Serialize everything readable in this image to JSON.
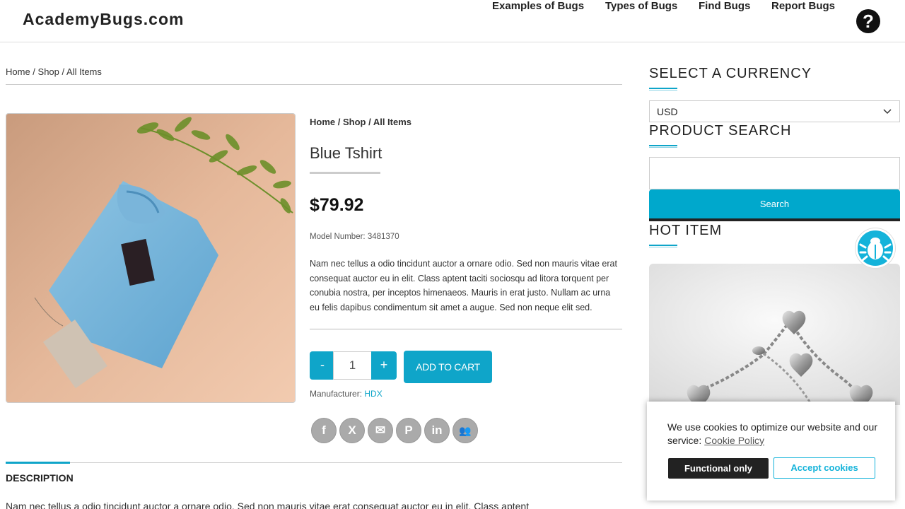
{
  "header": {
    "logo": "AcademyBugs.com",
    "nav": [
      "Examples of Bugs",
      "Types of Bugs",
      "Find Bugs",
      "Report Bugs"
    ],
    "help_icon": "question-circle-icon",
    "help_glyph": "?"
  },
  "breadcrumb_top": {
    "home": "Home",
    "sep1": " / ",
    "shop": "Shop",
    "sep2": " / ",
    "current": "All Items"
  },
  "product": {
    "breadcrumb": {
      "home": "Home",
      "sep1": " / ",
      "shop": "Shop",
      "sep2": " / ",
      "current": "All Items"
    },
    "title": "Blue Tshirt",
    "price": "$79.92",
    "model_label": "Model Number:",
    "model_number": "3481370",
    "description": "Nam nec tellus a odio tincidunt auctor a ornare odio. Sed non mauris vitae erat consequat auctor eu in elit. Class aptent taciti sociosqu ad litora torquent per conubia nostra, per inceptos himenaeos. Mauris in erat justo. Nullam ac urna eu felis dapibus condimentum sit amet a augue. Sed non neque elit sed.",
    "qty_minus": "-",
    "qty_value": "1",
    "qty_plus": "+",
    "add_to_cart": "ADD TO CART",
    "manufacturer_label": "Manufacturer:",
    "manufacturer": "HDX",
    "share_icons": [
      {
        "name": "facebook-icon",
        "glyph": "f"
      },
      {
        "name": "x-twitter-icon",
        "glyph": "X"
      },
      {
        "name": "email-icon",
        "glyph": "✉"
      },
      {
        "name": "pinterest-icon",
        "glyph": "P"
      },
      {
        "name": "linkedin-icon",
        "glyph": "in"
      },
      {
        "name": "myspace-icon",
        "glyph": "👥"
      }
    ]
  },
  "tabs": {
    "description_tab": "DESCRIPTION",
    "description_text": "Nam nec tellus a odio tincidunt auctor a ornare odio. Sed non mauris vitae erat consequat auctor eu in elit. Class aptent"
  },
  "sidebar": {
    "currency_heading": "SELECT A CURRENCY",
    "currency_value": "USD",
    "search_heading": "PRODUCT SEARCH",
    "search_placeholder": "",
    "search_button": "Search",
    "hot_item_heading": "HOT ITEM"
  },
  "cookie": {
    "text": "We use cookies to optimize our website and our service:",
    "policy_link": "Cookie Policy",
    "functional_button": "Functional only",
    "accept_button": "Accept cookies"
  },
  "colors": {
    "accent": "#0fa5c9",
    "dark": "#222222"
  }
}
